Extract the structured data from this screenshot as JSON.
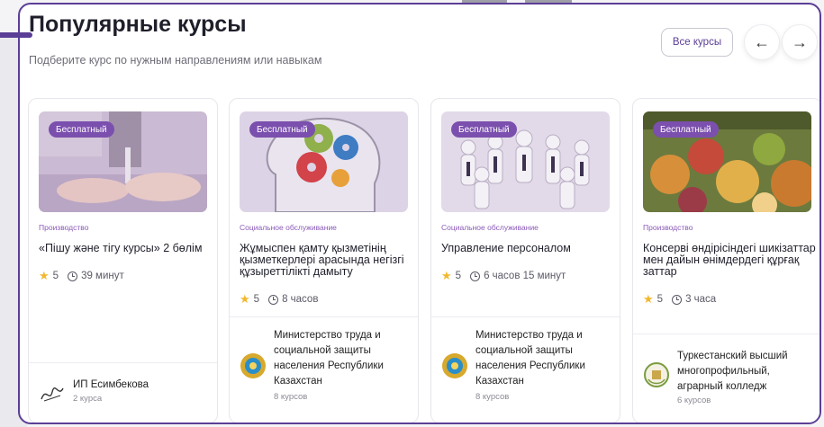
{
  "header": {
    "title": "Популярные курсы",
    "subtitle": "Подберите курс по нужным направлениям или навыкам",
    "all_courses_label": "Все курсы",
    "prev_arrow": "←",
    "next_arrow": "→"
  },
  "cards": [
    {
      "badge": "Бесплатный",
      "category": "Производство",
      "title": "«Пішу және тігу курсы» 2 бөлім",
      "rating": "5",
      "duration": "39 минут",
      "org_name": "ИП Есимбекова",
      "org_courses": "2 курса",
      "image_icon": "sewing-machine-photo",
      "org_logo_icon": "signature-logo-icon"
    },
    {
      "badge": "Бесплатный",
      "category": "Социальное обслуживание",
      "title": "Жұмыспен қамту қызметінің қызметкерлері арасында негізгі құзыреттілікті дамыту",
      "rating": "5",
      "duration": "8 часов",
      "org_name": "Министерство труда и социальной защиты населения Республики Казахстан",
      "org_courses": "8 курсов",
      "image_icon": "head-gears-illustration",
      "org_logo_icon": "kazakhstan-emblem-icon"
    },
    {
      "badge": "Бесплатный",
      "category": "Социальное обслуживание",
      "title": "Управление персоналом",
      "rating": "5",
      "duration": "6 часов 15 минут",
      "org_name": "Министерство труда и социальной защиты населения Республики Казахстан",
      "org_courses": "8 курсов",
      "image_icon": "team-figures-illustration",
      "org_logo_icon": "kazakhstan-emblem-icon"
    },
    {
      "badge": "Бесплатный",
      "category": "Производство",
      "title": "Консерві өндірісіндегі шикізаттар мен дайын өнімдердегі құрғақ заттар",
      "rating": "5",
      "duration": "3 часа",
      "org_name": "Туркестанский высший многопрофильный, аграрный колледж",
      "org_courses": "6 курсов",
      "image_icon": "vegetables-photo",
      "org_logo_icon": "college-crest-icon"
    }
  ],
  "colors": {
    "accent": "#5b3e96",
    "badge": "#7b4fae",
    "star": "#f2b72c"
  }
}
